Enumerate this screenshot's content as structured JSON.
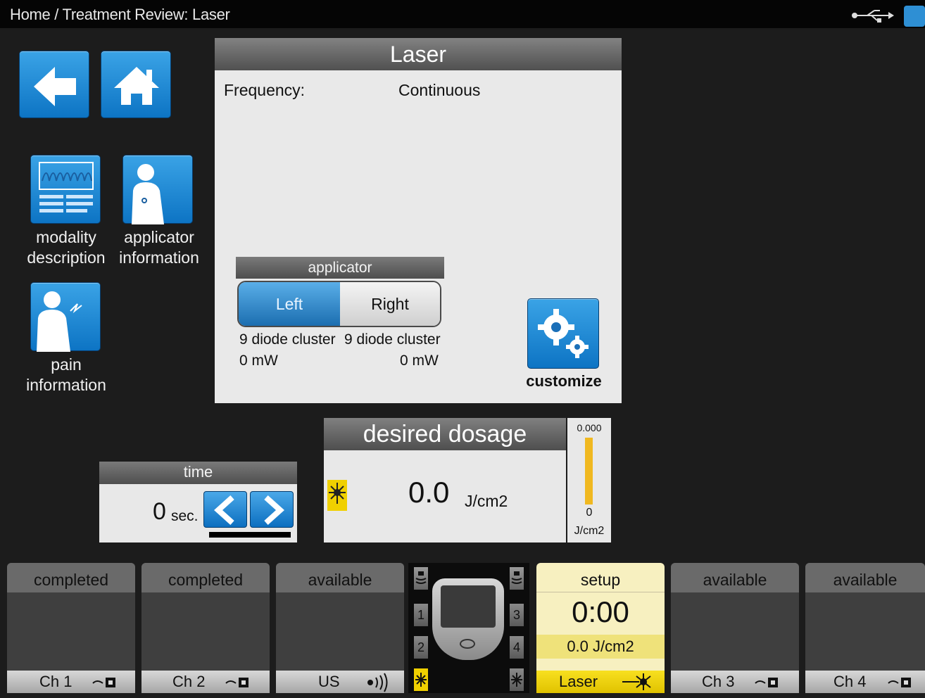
{
  "breadcrumb": "Home / Treatment Review: Laser",
  "nav": {
    "back_icon": "back-arrow-icon",
    "home_icon": "home-icon"
  },
  "sidebar": {
    "modality_label_1": "modality",
    "modality_label_2": "description",
    "applicator_label_1": "applicator",
    "applicator_label_2": "information",
    "pain_label_1": "pain",
    "pain_label_2": "information"
  },
  "panel": {
    "title": "Laser",
    "frequency_label": "Frequency:",
    "frequency_value": "Continuous",
    "applicator_title": "applicator",
    "left_label": "Left",
    "right_label": "Right",
    "left_desc": "9 diode cluster",
    "right_desc": "9 diode cluster",
    "left_power": "0 mW",
    "right_power": "0 mW",
    "customize_label": "customize"
  },
  "time": {
    "title": "time",
    "value": "0",
    "unit": "sec."
  },
  "dosage": {
    "title": "desired dosage",
    "value": "0.0",
    "unit": "J/cm2",
    "gauge_top": "0.000",
    "gauge_bottom": "0",
    "gauge_unit": "J/cm2"
  },
  "channels": [
    {
      "status": "completed",
      "label": "Ch 1"
    },
    {
      "status": "completed",
      "label": "Ch 2"
    },
    {
      "status": "available",
      "label": "US"
    },
    {
      "status": "setup",
      "label": "Laser",
      "time": "0:00",
      "dose": "0.0 J/cm2"
    },
    {
      "status": "available",
      "label": "Ch 3"
    },
    {
      "status": "available",
      "label": "Ch 4"
    }
  ],
  "center": {
    "btn1": "1",
    "btn2": "2",
    "btn3": "3",
    "btn4": "4"
  },
  "colors": {
    "accent_blue": "#1a82d2",
    "laser_yellow": "#f0d000"
  }
}
